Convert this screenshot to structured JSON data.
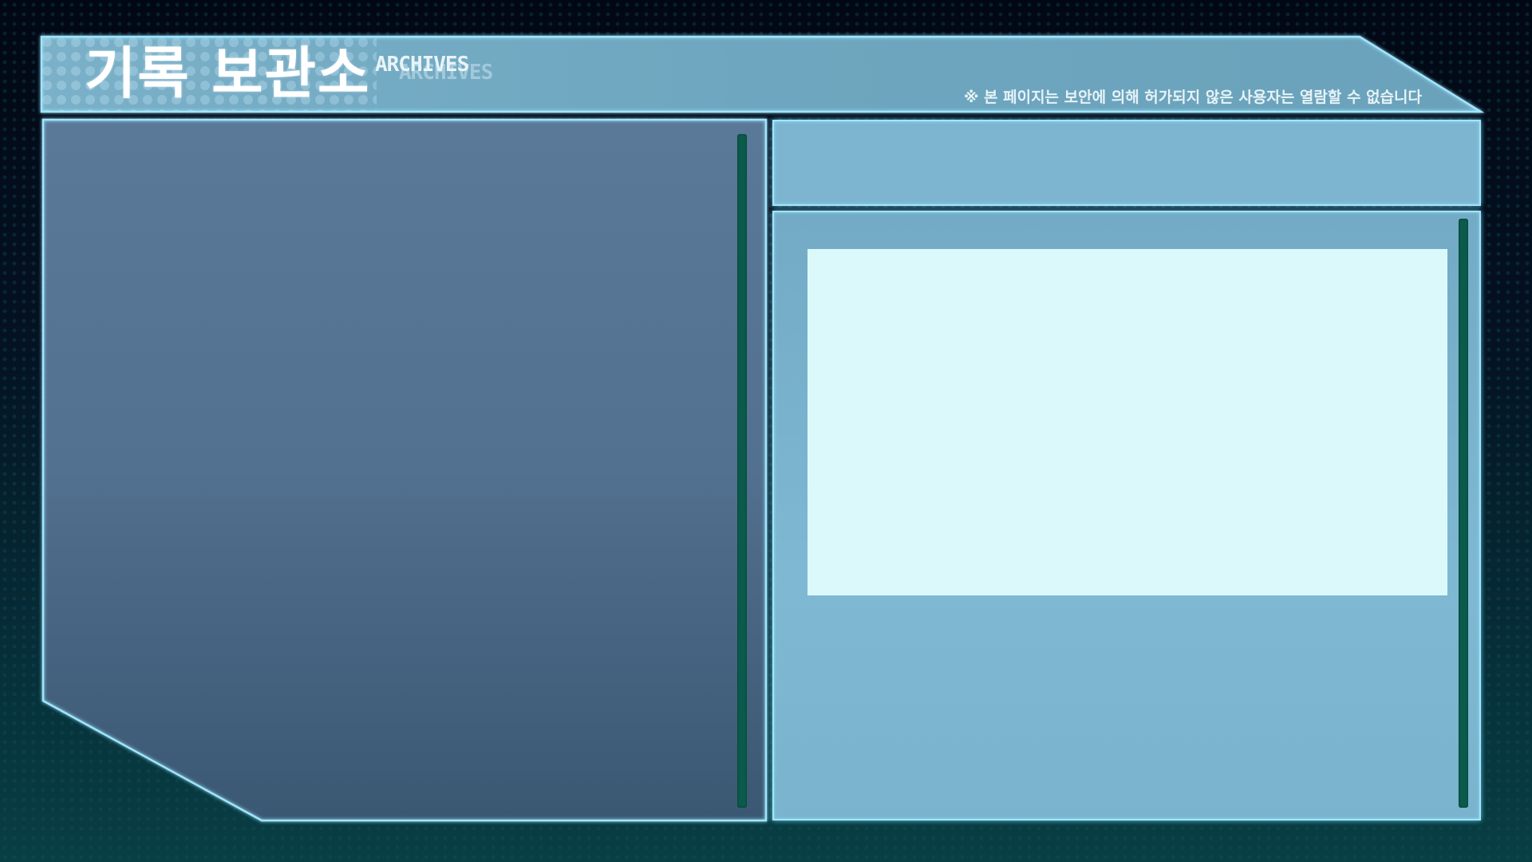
{
  "header": {
    "title": "기록 보관소",
    "subtitle": "ARCHIVES",
    "subtitle_ghost": "ARCHIVES",
    "notice": "※ 본 페이지는 보안에 의해 허가되지 않은 사용자는 열람할 수 없습니다"
  },
  "colors": {
    "background": "#020714",
    "header_fill": "#6aa3bd",
    "frame_glow": "#9fe6ff",
    "left_panel": "#557394",
    "right_panel": "#7db5d1",
    "content_box": "#dbf9fb",
    "scrollbar": "#0b5a4b"
  },
  "left_panel": {
    "scrollbar_icon": "vertical-scrollbar"
  },
  "right_panel": {
    "scrollbar_icon": "vertical-scrollbar"
  }
}
